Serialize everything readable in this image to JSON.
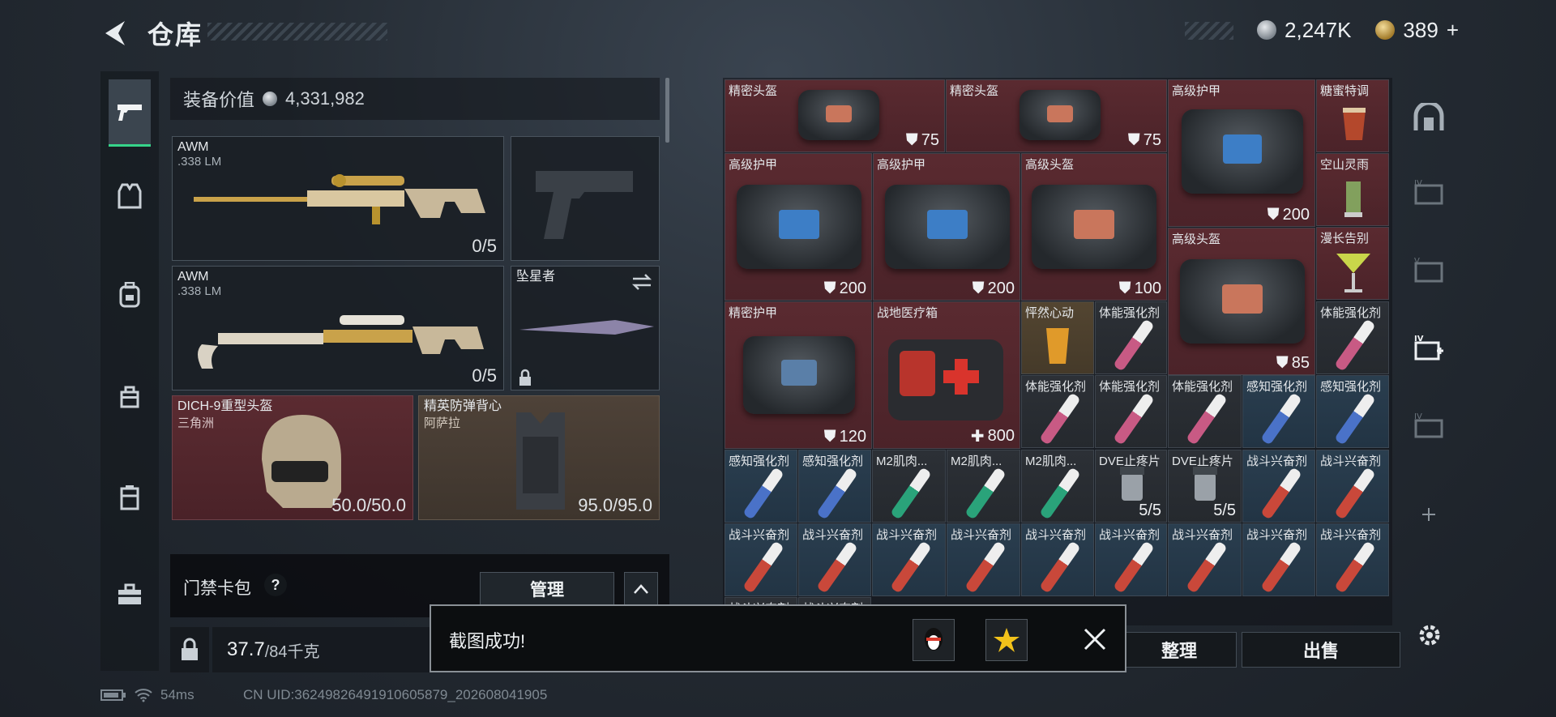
{
  "header": {
    "title": "仓库"
  },
  "currency": {
    "silver": "2,247K",
    "gold": "389",
    "gold_plus": "+"
  },
  "equipment": {
    "value_label": "装备价值",
    "value": "4,331,982",
    "primary1": {
      "name": "AWM",
      "ammo": ".338 LM",
      "count": "0/5"
    },
    "primary2": {
      "name": "AWM",
      "ammo": ".338 LM",
      "count": "0/5"
    },
    "melee": {
      "name": "坠星者"
    },
    "helmet": {
      "name": "DICH-9重型头盔",
      "sub": "三角洲",
      "durability": "50.0/50.0"
    },
    "armor": {
      "name": "精英防弹背心",
      "sub": "阿萨拉",
      "durability": "95.0/95.0"
    }
  },
  "card_pack": {
    "label": "门禁卡包",
    "help": "?",
    "manage": "管理"
  },
  "weight": {
    "current": "37.7",
    "max": "/84千克"
  },
  "status": {
    "ping": "54ms",
    "uid": "CN UID:3624982649191060587​9_202608041905"
  },
  "storage": {
    "items": [
      {
        "name": "精密头盔",
        "value": "75"
      },
      {
        "name": "精密头盔",
        "value": "75"
      },
      {
        "name": "高级护甲",
        "value": "200"
      },
      {
        "name": "糖蜜特调"
      },
      {
        "name": "高级护甲",
        "value": "200"
      },
      {
        "name": "高级护甲",
        "value": "200"
      },
      {
        "name": "高级头盔",
        "value": "100"
      },
      {
        "name": "空山灵雨"
      },
      {
        "name": "高级头盔",
        "value": "85"
      },
      {
        "name": "漫长告别"
      },
      {
        "name": "精密护甲",
        "value": "120"
      },
      {
        "name": "战地医疗箱",
        "value": "800"
      },
      {
        "name": "怦然心动"
      },
      {
        "name": "体能强化剂"
      },
      {
        "name": "体能强化剂"
      },
      {
        "name": "体能强化剂"
      },
      {
        "name": "体能强化剂"
      },
      {
        "name": "体能强化剂"
      },
      {
        "name": "感知强化剂"
      },
      {
        "name": "感知强化剂"
      },
      {
        "name": "感知强化剂"
      },
      {
        "name": "感知强化剂"
      },
      {
        "name": "M2肌肉..."
      },
      {
        "name": "M2肌肉..."
      },
      {
        "name": "M2肌肉..."
      },
      {
        "name": "DVE止疼片",
        "value": "5/5"
      },
      {
        "name": "DVE止疼片",
        "value": "5/5"
      },
      {
        "name": "战斗兴奋剂"
      },
      {
        "name": "战斗兴奋剂"
      },
      {
        "name": "战斗兴奋剂"
      },
      {
        "name": "战斗兴奋剂"
      },
      {
        "name": "战斗兴奋剂"
      },
      {
        "name": "战斗兴奋剂"
      },
      {
        "name": "战斗兴奋剂"
      },
      {
        "name": "战斗兴奋剂"
      },
      {
        "name": "战斗兴奋剂"
      },
      {
        "name": "战斗兴奋剂"
      },
      {
        "name": "战斗兴奋剂"
      },
      {
        "name": "战斗兴奋剂"
      },
      {
        "name": "战斗兴奋剂"
      }
    ]
  },
  "actions": {
    "sort": "整理",
    "sell": "出售"
  },
  "toast": {
    "text": "截图成功!"
  },
  "colors": {
    "accent": "#36d48a",
    "rare_red": "#5a2a30",
    "rare_blue": "#2a3e4f"
  }
}
